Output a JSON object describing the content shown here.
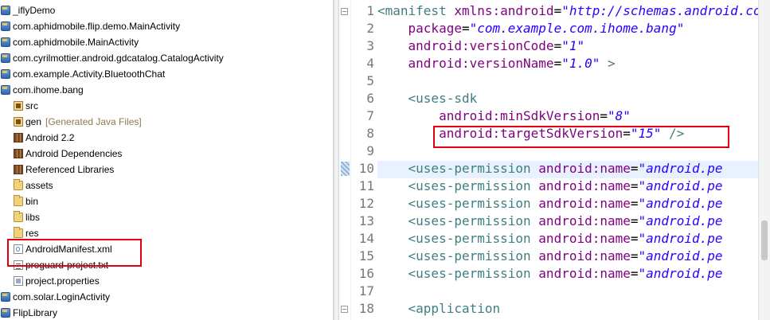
{
  "tree": {
    "nodes": [
      {
        "label": "_iflyDemo",
        "icon": "project-icon",
        "level": 0
      },
      {
        "label": "com.aphidmobile.flip.demo.MainActivity",
        "icon": "project-icon",
        "level": 0
      },
      {
        "label": "com.aphidmobile.MainActivity",
        "icon": "project-icon",
        "level": 0
      },
      {
        "label": "com.cyrilmottier.android.gdcatalog.CatalogActivity",
        "icon": "project-icon",
        "level": 0
      },
      {
        "label": "com.example.Activity.BluetoothChat",
        "icon": "project-icon",
        "level": 0
      },
      {
        "label": "com.ihome.bang",
        "icon": "project-icon",
        "level": 0
      },
      {
        "label": "src",
        "icon": "source-folder-icon",
        "level": 1
      },
      {
        "label": "gen",
        "extra": "[Generated Java Files]",
        "icon": "source-folder-icon",
        "level": 1
      },
      {
        "label": "Android 2.2",
        "icon": "library-icon",
        "level": 1
      },
      {
        "label": "Android Dependencies",
        "icon": "library-icon",
        "level": 1
      },
      {
        "label": "Referenced Libraries",
        "icon": "library-icon",
        "level": 1
      },
      {
        "label": "assets",
        "icon": "folder-icon",
        "level": 1
      },
      {
        "label": "bin",
        "icon": "folder-icon",
        "level": 1
      },
      {
        "label": "libs",
        "icon": "folder-icon",
        "level": 1
      },
      {
        "label": "res",
        "icon": "folder-icon",
        "level": 1
      },
      {
        "label": "AndroidManifest.xml",
        "icon": "xml-file-icon",
        "level": 1
      },
      {
        "label": "proguard-project.txt",
        "icon": "text-file-icon",
        "level": 1
      },
      {
        "label": "project.properties",
        "icon": "properties-file-icon",
        "level": 1
      },
      {
        "label": "com.solar.LoginActivity",
        "icon": "project-icon",
        "level": 0
      },
      {
        "label": "FlipLibrary",
        "icon": "project-icon",
        "level": 0
      }
    ]
  },
  "editor": {
    "line_numbers": [
      "1",
      "2",
      "3",
      "4",
      "5",
      "6",
      "7",
      "8",
      "9",
      "10",
      "11",
      "12",
      "13",
      "14",
      "15",
      "16",
      "17",
      "18"
    ],
    "current_line": "10",
    "lines": [
      {
        "tokens": [
          {
            "t": "<manifest ",
            "c": "tag"
          },
          {
            "t": "xmlns:android",
            "c": "attr"
          },
          {
            "t": "=",
            "c": "eq"
          },
          {
            "t": "\"http://schemas.android.com/apk/res/android\"",
            "c": "val"
          }
        ]
      },
      {
        "tokens": [
          {
            "t": "    "
          },
          {
            "t": "package",
            "c": "attr"
          },
          {
            "t": "=",
            "c": "eq"
          },
          {
            "t": "\"com.example.com.ihome.bang\"",
            "c": "val"
          }
        ]
      },
      {
        "tokens": [
          {
            "t": "    "
          },
          {
            "t": "android:versionCode",
            "c": "attr"
          },
          {
            "t": "=",
            "c": "eq"
          },
          {
            "t": "\"1\"",
            "c": "val"
          }
        ]
      },
      {
        "tokens": [
          {
            "t": "    "
          },
          {
            "t": "android:versionName",
            "c": "attr"
          },
          {
            "t": "=",
            "c": "eq"
          },
          {
            "t": "\"1.0\"",
            "c": "val"
          },
          {
            "t": " >",
            "c": "tag"
          }
        ]
      },
      {
        "tokens": []
      },
      {
        "tokens": [
          {
            "t": "    "
          },
          {
            "t": "<uses-sdk",
            "c": "tag"
          }
        ]
      },
      {
        "tokens": [
          {
            "t": "        "
          },
          {
            "t": "android:minSdkVersion",
            "c": "attr"
          },
          {
            "t": "=",
            "c": "eq"
          },
          {
            "t": "\"8\"",
            "c": "val"
          }
        ]
      },
      {
        "tokens": [
          {
            "t": "        "
          },
          {
            "t": "android:targetSdkVersion",
            "c": "attr"
          },
          {
            "t": "=",
            "c": "eq"
          },
          {
            "t": "\"15\"",
            "c": "val"
          },
          {
            "t": " />",
            "c": "tag"
          }
        ]
      },
      {
        "tokens": []
      },
      {
        "tokens": [
          {
            "t": "    "
          },
          {
            "t": "<uses-permission ",
            "c": "tag"
          },
          {
            "t": "android:name",
            "c": "attr"
          },
          {
            "t": "=",
            "c": "eq"
          },
          {
            "t": "\"android.pe",
            "c": "val"
          }
        ]
      },
      {
        "tokens": [
          {
            "t": "    "
          },
          {
            "t": "<uses-permission ",
            "c": "tag"
          },
          {
            "t": "android:name",
            "c": "attr"
          },
          {
            "t": "=",
            "c": "eq"
          },
          {
            "t": "\"android.pe",
            "c": "val"
          }
        ]
      },
      {
        "tokens": [
          {
            "t": "    "
          },
          {
            "t": "<uses-permission ",
            "c": "tag"
          },
          {
            "t": "android:name",
            "c": "attr"
          },
          {
            "t": "=",
            "c": "eq"
          },
          {
            "t": "\"android.pe",
            "c": "val"
          }
        ]
      },
      {
        "tokens": [
          {
            "t": "    "
          },
          {
            "t": "<uses-permission ",
            "c": "tag"
          },
          {
            "t": "android:name",
            "c": "attr"
          },
          {
            "t": "=",
            "c": "eq"
          },
          {
            "t": "\"android.pe",
            "c": "val"
          }
        ]
      },
      {
        "tokens": [
          {
            "t": "    "
          },
          {
            "t": "<uses-permission ",
            "c": "tag"
          },
          {
            "t": "android:name",
            "c": "attr"
          },
          {
            "t": "=",
            "c": "eq"
          },
          {
            "t": "\"android.pe",
            "c": "val"
          }
        ]
      },
      {
        "tokens": [
          {
            "t": "    "
          },
          {
            "t": "<uses-permission ",
            "c": "tag"
          },
          {
            "t": "android:name",
            "c": "attr"
          },
          {
            "t": "=",
            "c": "eq"
          },
          {
            "t": "\"android.pe",
            "c": "val"
          }
        ]
      },
      {
        "tokens": [
          {
            "t": "    "
          },
          {
            "t": "<uses-permission ",
            "c": "tag"
          },
          {
            "t": "android:name",
            "c": "attr"
          },
          {
            "t": "=",
            "c": "eq"
          },
          {
            "t": "\"android.pe",
            "c": "val"
          }
        ]
      },
      {
        "tokens": []
      },
      {
        "tokens": [
          {
            "t": "    "
          },
          {
            "t": "<application",
            "c": "tag"
          }
        ]
      }
    ]
  },
  "colors": {
    "highlight_box": "#e0000f",
    "xml_tag": "#3f7f7f",
    "xml_attribute": "#7f007f",
    "xml_value": "#2a00ff",
    "current_line_bg": "#e8f2fe"
  }
}
